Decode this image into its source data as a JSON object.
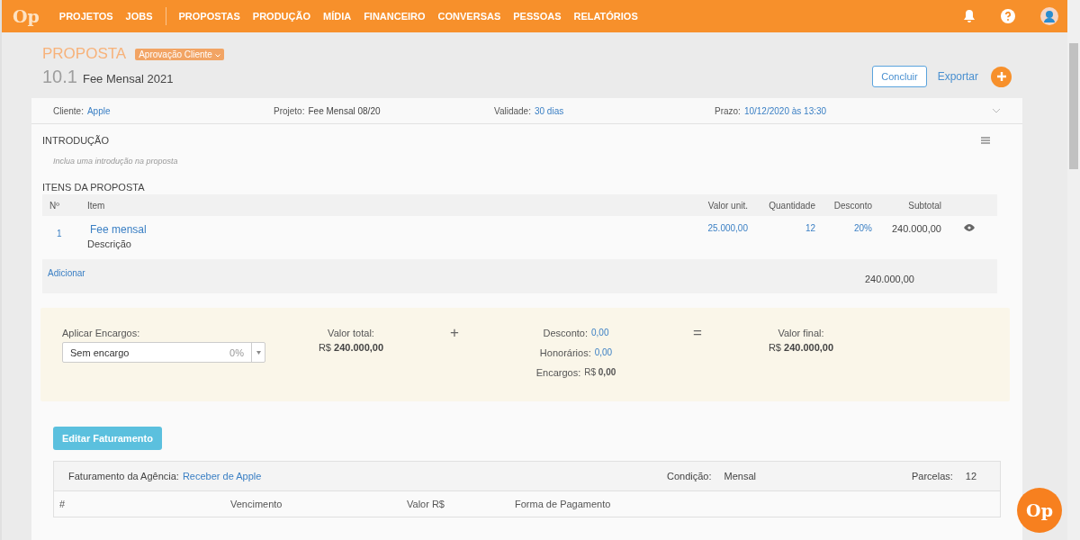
{
  "nav": {
    "logo": "Op",
    "groups": [
      [
        "PROJETOS",
        "JOBS"
      ],
      [
        "PROPOSTAS",
        "PRODUÇÃO",
        "MÍDIA",
        "FINANCEIRO",
        "CONVERSAS",
        "PESSOAS",
        "RELATÓRIOS"
      ]
    ]
  },
  "header": {
    "section": "PROPOSTA",
    "status": "Aprovação Cliente",
    "number": "10.1",
    "title": "Fee Mensal 2021",
    "buttons": [
      {
        "label": "Concluir",
        "kind": "outline"
      },
      {
        "label": "Exportar",
        "kind": "link"
      }
    ]
  },
  "info": [
    {
      "label": "Cliente:",
      "value": "Apple",
      "kind": "link"
    },
    {
      "label": "Projeto:",
      "value": "Fee Mensal 08/20",
      "kind": "text"
    },
    {
      "label": "Validade:",
      "value": "30 dias",
      "kind": "link"
    },
    {
      "label": "Prazo:",
      "value": "10/12/2020 às 13:30",
      "kind": "link"
    }
  ],
  "intro": {
    "title": "INTRODUÇÃO",
    "placeholder": "Inclua uma introdução na proposta"
  },
  "items": {
    "title": "ITENS DA PROPOSTA",
    "columns": [
      "Nº",
      "Item",
      "Valor unit.",
      "Quantidade",
      "Desconto",
      "Subtotal"
    ],
    "rows": [
      {
        "number": "1",
        "name": "Fee mensal",
        "description": "Descrição",
        "unit_value": "25.000,00",
        "quantity": "12",
        "discount": "20%",
        "subtotal": "240.000,00"
      }
    ],
    "add": "Adicionar",
    "total": "240.000,00"
  },
  "summary": {
    "charges_label": "Aplicar Encargos:",
    "charges_value": "Sem encargo",
    "charges_percent": "0%",
    "total_label": "Valor total:",
    "total_value": "R$ **240.000,00**",
    "plus": "+",
    "adjustments": [
      {
        "label": "Desconto:",
        "value": "0,00",
        "kind": "link"
      },
      {
        "label": "Honorários:",
        "value": "0,00",
        "kind": "link"
      },
      {
        "label": "Encargos:",
        "value": "R$ **0,00**",
        "kind": "text"
      }
    ],
    "equals": "=",
    "final_label": "Valor final:",
    "final_value": "R$ **240.000,00**"
  },
  "billing": {
    "button": "Editar Faturamento",
    "agency_label": "Faturamento da Agência:",
    "agency_value": "Receber de Apple",
    "condition_label": "Condição:",
    "condition_value": "Mensal",
    "installments_label": "Parcelas:",
    "installments_value": "12",
    "columns": [
      "#",
      "Vencimento",
      "Valor R$",
      "Forma de Pagamento"
    ]
  },
  "fab": "Op"
}
